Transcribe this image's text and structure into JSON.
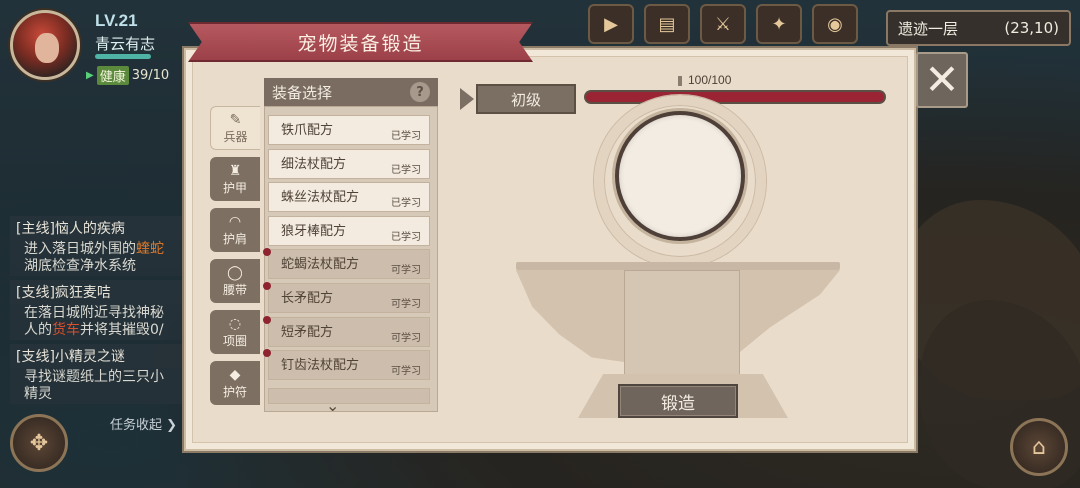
{
  "player": {
    "level": "LV.21",
    "name": "青云有志",
    "xp_fraction": 0.62,
    "status": "健康",
    "hp": "39/10"
  },
  "hud": {
    "location_name": "遗迹一层",
    "coords": "(23,10)"
  },
  "quests": [
    {
      "title": "[主线]恼人的疾病",
      "desc_parts": [
        "进入落日城外围的",
        "蝰蛇",
        "湖底检查净水系统"
      ]
    },
    {
      "title": "[支线]疯狂麦咭",
      "desc_parts": [
        "在落日城附近寻找神秘",
        "人的",
        "货车",
        "并将其摧毁0/"
      ]
    },
    {
      "title": "[支线]小精灵之谜",
      "desc_parts": [
        "寻找谜题纸上的三只小",
        "精灵"
      ]
    }
  ],
  "quest_collapse": "任务收起",
  "dialog": {
    "title": "宠物装备锻造",
    "close_icon": "✕",
    "tabs": [
      {
        "label": "兵器",
        "icon": "sword-icon"
      },
      {
        "label": "护甲",
        "icon": "armor-icon"
      },
      {
        "label": "护肩",
        "icon": "shoulder-icon"
      },
      {
        "label": "腰带",
        "icon": "belt-icon"
      },
      {
        "label": "项圈",
        "icon": "collar-icon"
      },
      {
        "label": "护符",
        "icon": "amulet-icon"
      }
    ],
    "list_header": "装备选择",
    "help_icon": "?",
    "recipes": [
      {
        "name": "铁爪配方",
        "state": "已学习"
      },
      {
        "name": "细法杖配方",
        "state": "已学习"
      },
      {
        "name": "蛛丝法杖配方",
        "state": "已学习"
      },
      {
        "name": "狼牙棒配方",
        "state": "已学习"
      },
      {
        "name": "蛇蝎法杖配方",
        "state": "可学习"
      },
      {
        "name": "长矛配方",
        "state": "可学习"
      },
      {
        "name": "短矛配方",
        "state": "可学习"
      },
      {
        "name": "钉齿法杖配方",
        "state": "可学习"
      }
    ],
    "level_label": "初级",
    "progress_text": "100/100",
    "progress_fraction": 1.0,
    "forge_button": "锻造"
  },
  "colors": {
    "ribbon": "#a84a52",
    "progress": "#9b2434",
    "learnable_dot": "#8e2430"
  }
}
